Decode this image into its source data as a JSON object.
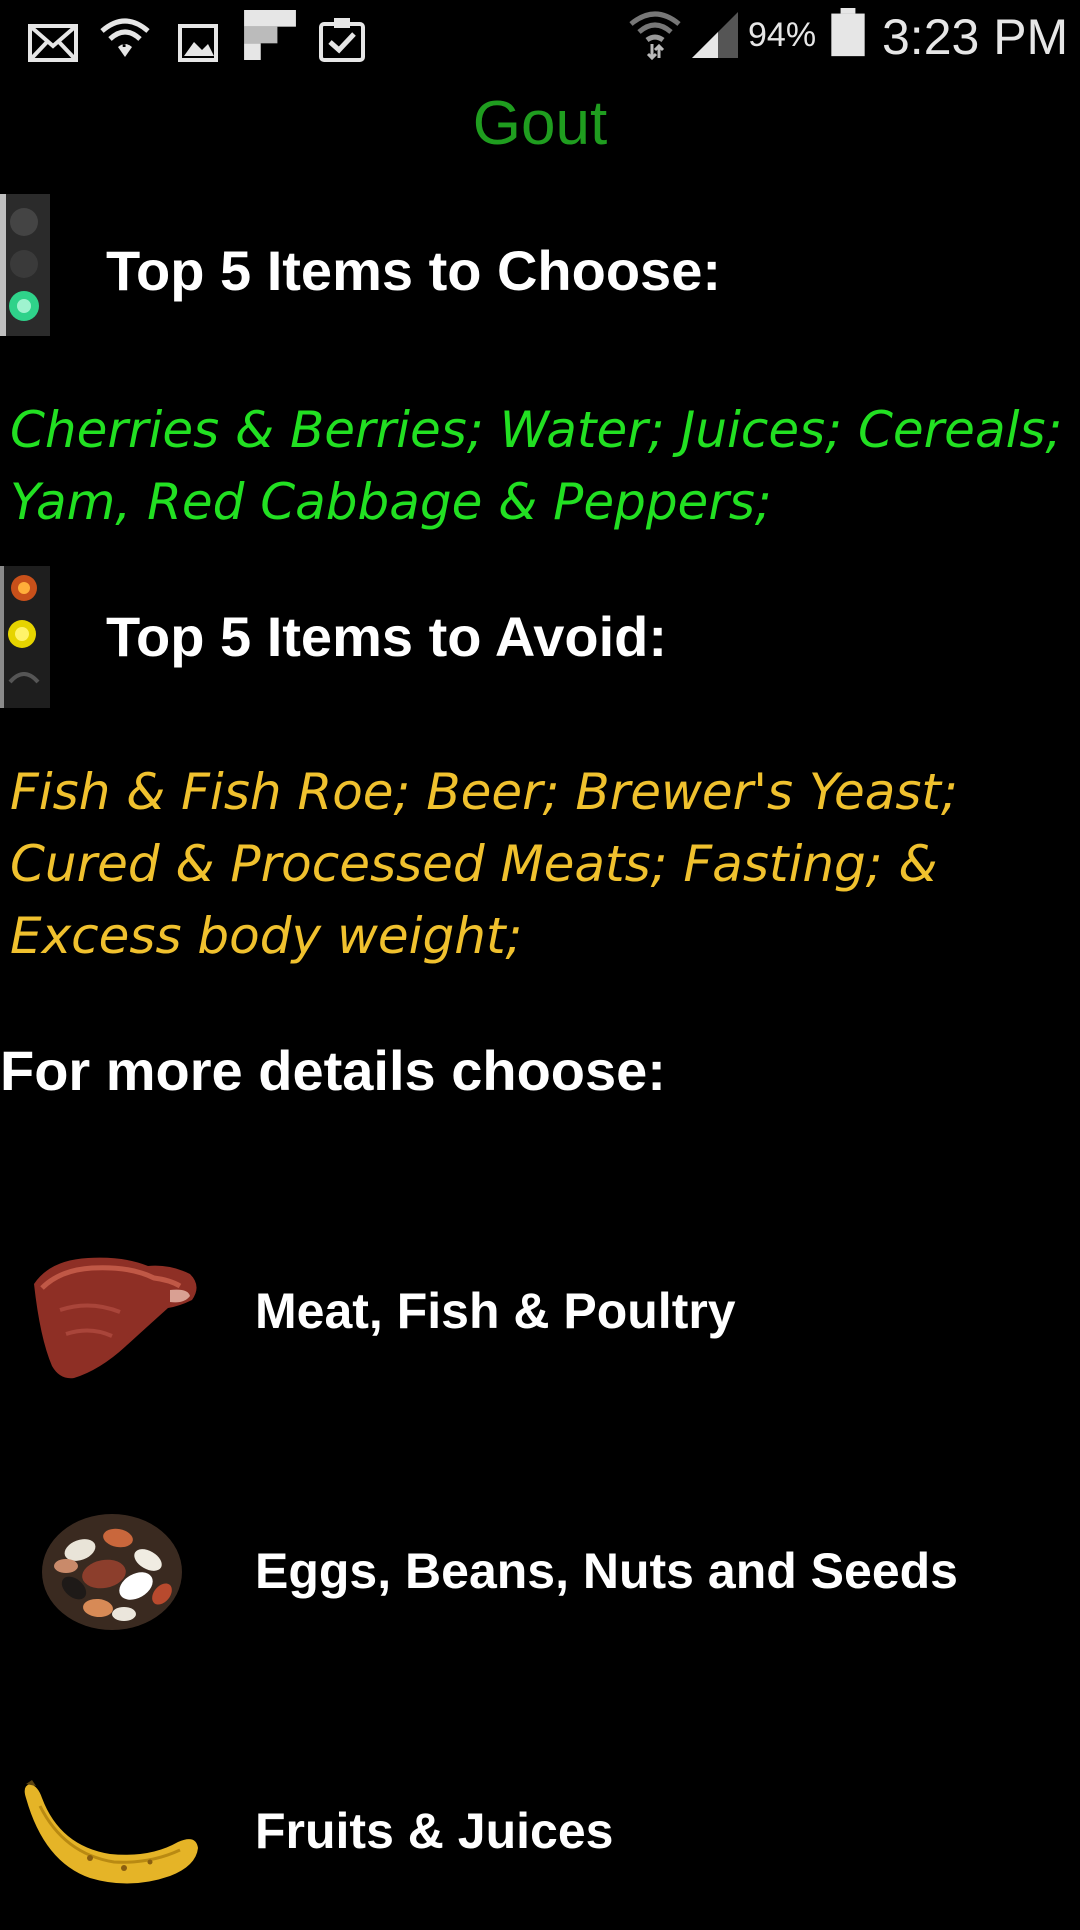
{
  "status_bar": {
    "icons": [
      "mail-icon",
      "wifi-icon",
      "image-icon",
      "flipboard-icon",
      "clipboard-check-icon",
      "wifi-signal-icon",
      "cell-signal-icon",
      "battery-icon"
    ],
    "battery_percent": "94%",
    "time": "3:23 PM"
  },
  "page": {
    "title": "Gout"
  },
  "choose_section": {
    "heading": "Top 5 Items to Choose:",
    "body": "Cherries & Berries; Water; Juices; Cereals; Yam, Red Cabbage & Peppers;",
    "icon": "traffic-light-green-icon"
  },
  "avoid_section": {
    "heading": "Top 5 Items to Avoid:",
    "body": "Fish & Fish Roe; Beer; Brewer's Yeast; Cured & Processed Meats; Fasting; & Excess body weight;",
    "icon": "traffic-light-yellow-icon"
  },
  "details": {
    "heading": "For more details choose:",
    "categories": [
      {
        "label": "Meat, Fish & Poultry",
        "icon": "steak-icon"
      },
      {
        "label": "Eggs, Beans, Nuts and Seeds",
        "icon": "beans-icon"
      },
      {
        "label": "Fruits & Juices",
        "icon": "banana-icon"
      }
    ]
  },
  "colors": {
    "background": "#000000",
    "title": "#1f9d1f",
    "choose_text": "#22e022",
    "avoid_text": "#f0c12e",
    "heading_text": "#ffffff"
  }
}
